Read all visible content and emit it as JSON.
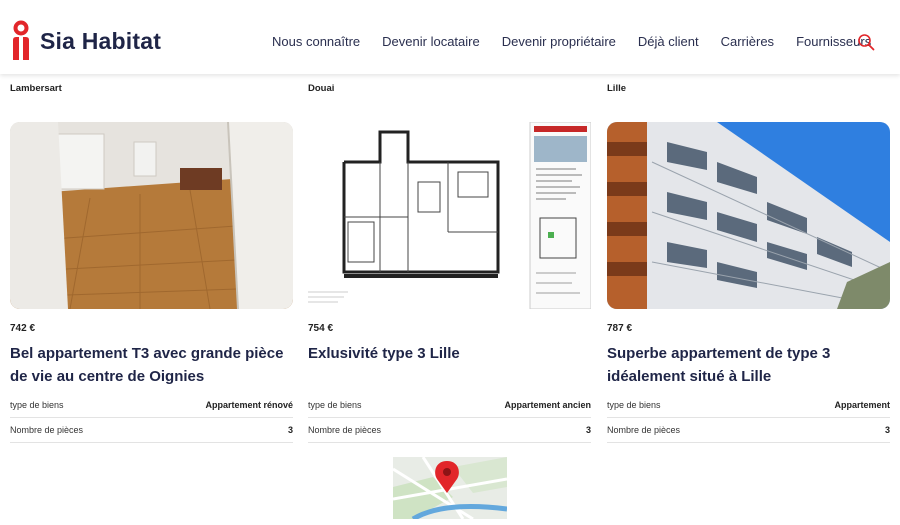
{
  "header": {
    "brand": "Sia Habitat",
    "nav": [
      {
        "label": "Nous connaître"
      },
      {
        "label": "Devenir locataire"
      },
      {
        "label": "Devenir propriétaire"
      },
      {
        "label": "Déjà client"
      },
      {
        "label": "Carrières"
      },
      {
        "label": "Fournisseurs"
      }
    ],
    "search_icon": "search-icon",
    "accent_color": "#e2262a"
  },
  "listings": [
    {
      "city": "Lambersart",
      "price": "742 €",
      "title": "Bel appartement T3 avec grande pièce de vie au centre de Oignies",
      "type_label": "type de biens",
      "type_value": "Appartement rénové",
      "rooms_label": "Nombre de pièces",
      "rooms_value": "3"
    },
    {
      "city": "Douai",
      "price": "754 €",
      "title": "Exlusivité type 3 Lille",
      "type_label": "type de biens",
      "type_value": "Appartement ancien",
      "rooms_label": "Nombre de pièces",
      "rooms_value": "3"
    },
    {
      "city": "Lille",
      "price": "787 €",
      "title": "Superbe appartement de type 3 idéalement situé à Lille",
      "type_label": "type de biens",
      "type_value": "Appartement",
      "rooms_label": "Nombre de pièces",
      "rooms_value": "3"
    }
  ],
  "map": {
    "icon": "map-pin-icon"
  }
}
